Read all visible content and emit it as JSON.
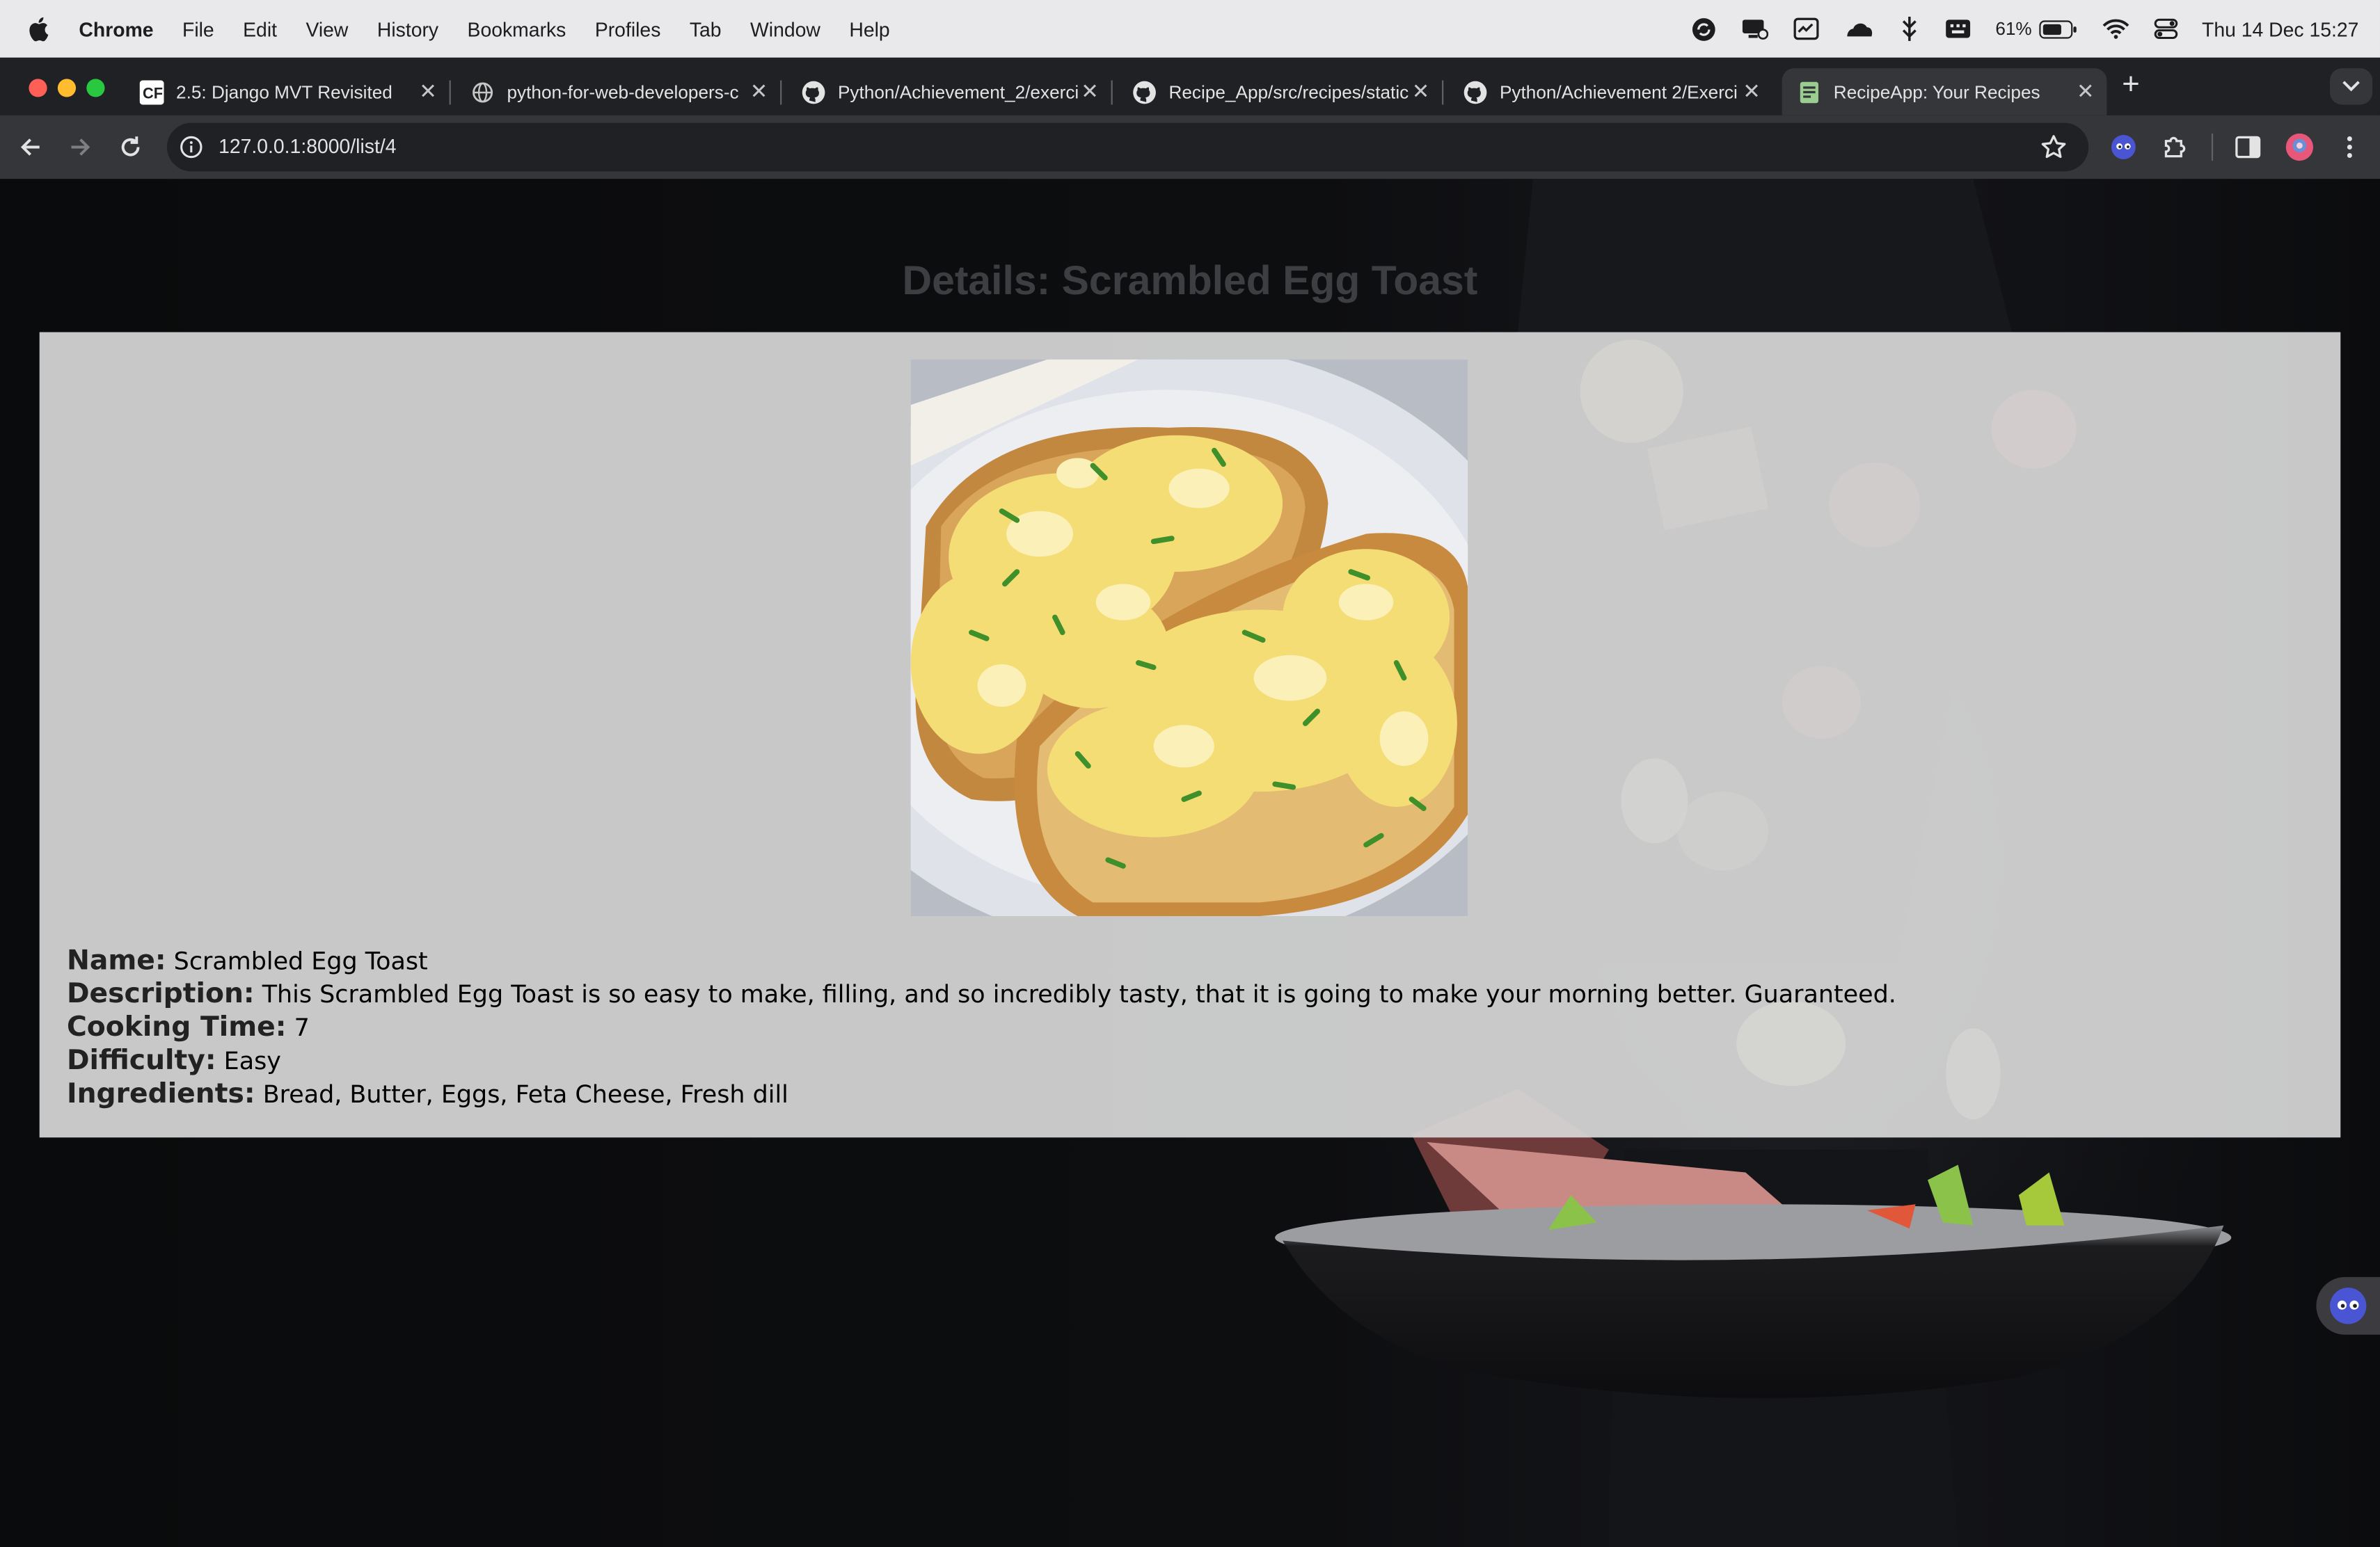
{
  "menubar": {
    "app": "Chrome",
    "items": [
      "File",
      "Edit",
      "View",
      "History",
      "Bookmarks",
      "Profiles",
      "Tab",
      "Window",
      "Help"
    ],
    "battery": "61%",
    "clock": "Thu 14 Dec  15:27"
  },
  "tabs": [
    {
      "title": "2.5: Django MVT Revisited",
      "icon": "careerfoundry-icon"
    },
    {
      "title": "python-for-web-developers-c",
      "icon": "globe-icon"
    },
    {
      "title": "Python/Achievement_2/exerci",
      "icon": "github-icon"
    },
    {
      "title": "Recipe_App/src/recipes/static",
      "icon": "github-icon"
    },
    {
      "title": "Python/Achievement 2/Exerci",
      "icon": "github-icon"
    },
    {
      "title": "RecipeApp: Your Recipes",
      "icon": "recipe-favicon",
      "active": true
    }
  ],
  "address_bar": {
    "url": "127.0.0.1:8000/list/4"
  },
  "page": {
    "title": "Details: Scrambled Egg Toast",
    "image_alt": "Scrambled egg toast photo",
    "fields": [
      {
        "label": "Name:",
        "value": "Scrambled Egg Toast"
      },
      {
        "label": "Description:",
        "value": "This Scrambled Egg Toast is so easy to make, filling, and so incredibly tasty, that it is going to make your morning better. Guaranteed."
      },
      {
        "label": "Cooking Time:",
        "value": "7"
      },
      {
        "label": "Difficulty:",
        "value": "Easy"
      },
      {
        "label": "Ingredients:",
        "value": "Bread, Butter, Eggs, Feta Cheese, Fresh dill"
      }
    ]
  },
  "colors": {
    "menubar_bg": "#e9e8ea",
    "tabstrip_bg": "#202124",
    "toolbar_bg": "#35363a",
    "card_bg": "#d7d7d7",
    "title_color": "#3d3e41"
  }
}
